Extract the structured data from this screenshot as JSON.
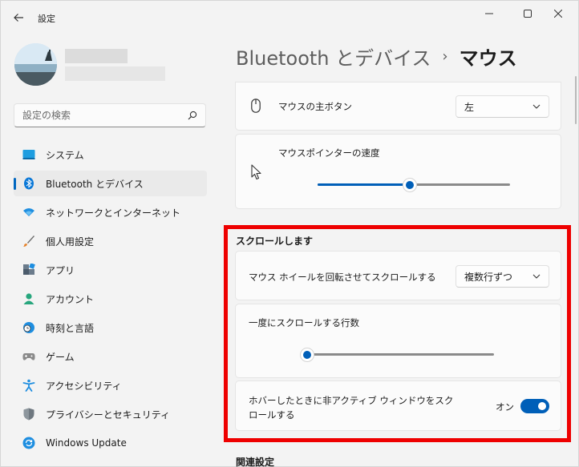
{
  "window": {
    "title": "設定",
    "back_icon": "back-arrow-icon",
    "minimize_icon": "minimize-icon",
    "maximize_icon": "maximize-icon",
    "close_icon": "close-icon"
  },
  "search": {
    "placeholder": "設定の検索",
    "icon": "search-icon"
  },
  "sidebar": {
    "items": [
      {
        "label": "システム",
        "icon": "system-icon",
        "active": false
      },
      {
        "label": "Bluetooth とデバイス",
        "icon": "bluetooth-icon",
        "active": true
      },
      {
        "label": "ネットワークとインターネット",
        "icon": "wifi-icon",
        "active": false
      },
      {
        "label": "個人用設定",
        "icon": "brush-icon",
        "active": false
      },
      {
        "label": "アプリ",
        "icon": "apps-icon",
        "active": false
      },
      {
        "label": "アカウント",
        "icon": "account-icon",
        "active": false
      },
      {
        "label": "時刻と言語",
        "icon": "clock-globe-icon",
        "active": false
      },
      {
        "label": "ゲーム",
        "icon": "gamepad-icon",
        "active": false
      },
      {
        "label": "アクセシビリティ",
        "icon": "accessibility-icon",
        "active": false
      },
      {
        "label": "プライバシーとセキュリティ",
        "icon": "shield-icon",
        "active": false
      },
      {
        "label": "Windows Update",
        "icon": "update-icon",
        "active": false
      }
    ]
  },
  "header": {
    "parent": "Bluetooth とデバイス",
    "separator": "›",
    "current": "マウス"
  },
  "primary_button": {
    "label": "マウスの主ボタン",
    "value": "左",
    "icon": "mouse-icon"
  },
  "pointer_speed": {
    "label": "マウスポインターの速度",
    "icon": "cursor-icon",
    "level": 0.48
  },
  "scroll_section": {
    "title": "スクロールします",
    "wheel": {
      "label": "マウス ホイールを回転させてスクロールする",
      "value": "複数行ずつ"
    },
    "lines": {
      "label": "一度にスクロールする行数",
      "level": 0.03
    },
    "inactive": {
      "label_line1": "ホバーしたときに非アクティブ ウィンドウをスク",
      "label_line2": "ロールする",
      "state": "オン"
    }
  },
  "related": {
    "title": "関連設定"
  },
  "colors": {
    "accent": "#005fb8",
    "highlight": "#ee0000"
  }
}
